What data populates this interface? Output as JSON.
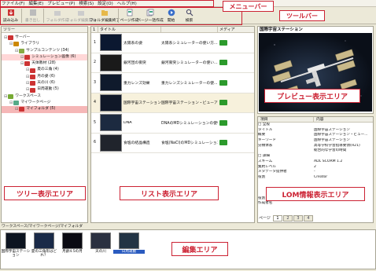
{
  "menubar": [
    "ファイル(F)",
    "編集(E)",
    "プレビュー(P)",
    "検索(S)",
    "設定(O)",
    "ヘルプ(H)"
  ],
  "toolbar": {
    "items": [
      {
        "label": "読み込み",
        "icon": "load-icon",
        "enabled": true
      },
      {
        "label": "書き出し",
        "icon": "export-icon",
        "enabled": false
      },
      {
        "label": "フォルダ作成",
        "icon": "folder-new-icon",
        "enabled": false
      },
      {
        "label": "フォルダ編集開始",
        "icon": "folder-edit-icon",
        "enabled": false
      },
      {
        "label": "フォルダ編集終了",
        "icon": "folder-end-icon",
        "enabled": true
      },
      {
        "label": "ページ作成",
        "icon": "page-new-icon",
        "enabled": true
      },
      {
        "label": "ページ一括作成",
        "icon": "page-batch-icon",
        "enabled": true
      },
      {
        "label": "開始",
        "icon": "play-icon",
        "enabled": true
      },
      {
        "label": "検索",
        "icon": "search-icon",
        "enabled": true
      }
    ]
  },
  "tree": {
    "header": "ツリー",
    "rows": [
      {
        "label": "サーバー",
        "indent": 0,
        "color": "#c33"
      },
      {
        "label": "ライブラリ",
        "indent": 1,
        "color": "#c80"
      },
      {
        "label": "サンプルコンテンツ (34)",
        "indent": 2,
        "color": "#8a4"
      },
      {
        "label": "シミュレーション画像 (6)",
        "indent": 3,
        "color": "#c33",
        "state": "sel2"
      },
      {
        "label": "天体教材 (28)",
        "indent": 3,
        "color": "#c33"
      },
      {
        "label": "夏の三角 (4)",
        "indent": 4,
        "color": "#c33"
      },
      {
        "label": "月の姿 (6)",
        "indent": 4,
        "color": "#c33"
      },
      {
        "label": "天の川 (6)",
        "indent": 4,
        "color": "#c33"
      },
      {
        "label": "日周運動 (5)",
        "indent": 4,
        "color": "#c33"
      },
      {
        "label": "ワークスペース",
        "indent": 0,
        "color": "#7a3"
      },
      {
        "label": "マイワークページ",
        "indent": 1,
        "color": "#5a8"
      },
      {
        "label": "マイフォルダ (5)",
        "indent": 2,
        "color": "#c33",
        "state": "sel"
      }
    ]
  },
  "list": {
    "columns": [
      "1",
      "タイトル",
      "",
      "メディア"
    ],
    "rows": [
      {
        "num": "1",
        "title": "太陽系の姿",
        "desc": "太陽系シミュレーターの使い方..."
      },
      {
        "num": "2",
        "title": "銀河団の衝突",
        "desc": "銀河衝突シミュレーターの使い..."
      },
      {
        "num": "3",
        "title": "重力レンズ効果",
        "desc": "重力レンズシミュレーターの使..."
      },
      {
        "num": "4",
        "title": "国際宇宙ステーション",
        "desc": "国際宇宙ステーション・ビューア...",
        "selected": true
      },
      {
        "num": "5",
        "title": "DNA",
        "desc": "DNAのMDシミュレーションの使い..."
      },
      {
        "num": "6",
        "title": "食塩の結晶構造",
        "desc": "食塩(NaCl)のMDシミュレーション..."
      }
    ]
  },
  "preview": {
    "title": "国際宇宙ステーション"
  },
  "lom": {
    "columns": [
      "項目",
      "内容"
    ],
    "rows": [
      {
        "k": "□ 全般",
        "v": ""
      },
      {
        "k": "   タイトル",
        "v": "国際宇宙ステーション"
      },
      {
        "k": "   概要",
        "v": "国際宇宙ステーション・ビュー..."
      },
      {
        "k": "   キーワード",
        "v": "国際宇宙ステーション"
      },
      {
        "k": "   分類体系",
        "v": "高等学校学習指導要領(H21)"
      },
      {
        "k": "",
        "v": "総合的な学習の時間"
      },
      {
        "k": "□ 詳細",
        "v": ""
      },
      {
        "k": "   スキーム",
        "v": "ADL SCORM 1.2"
      },
      {
        "k": "   集約レベル",
        "v": "2"
      },
      {
        "k": "   メタデータ提供者",
        "v": "-"
      },
      {
        "k": "      役割",
        "v": "Creator"
      },
      {
        "k": "",
        "v": ""
      },
      {
        "k": "",
        "v": ""
      },
      {
        "k": "",
        "v": ""
      },
      {
        "k": "      役割",
        "v": "Author"
      },
      {
        "k": "      作成者名",
        "v": ""
      }
    ],
    "pages_label": "ページ",
    "pages": [
      "1",
      "2",
      "3",
      "4"
    ]
  },
  "edit": {
    "path": "ワークスペース/マイワークページ/マイフォルダ",
    "items": [
      {
        "caption": "国際宇宙ステーション"
      },
      {
        "caption": "夏の三角形はどれ？"
      },
      {
        "caption": "月齢4.5の月"
      },
      {
        "caption": "天の川"
      },
      {
        "caption": "日周運動",
        "selected": true
      }
    ]
  },
  "annotations": {
    "menubar": "メニューバー",
    "toolbar": "ツールバー",
    "preview": "プレビュー表示エリア",
    "lom": "LOM情報表示エリア",
    "tree": "ツリー表示エリア",
    "list": "リスト表示エリア",
    "edit": "編集エリア"
  },
  "colors": {
    "accent": "#cc2233",
    "selection": "#f5b7b7"
  }
}
